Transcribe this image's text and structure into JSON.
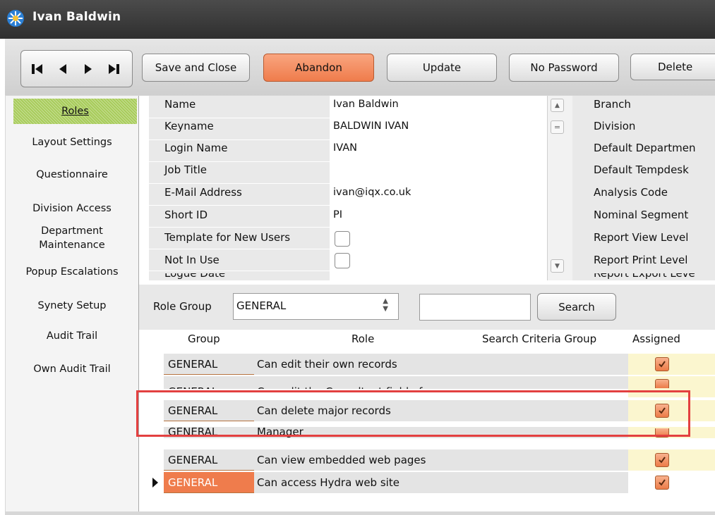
{
  "window": {
    "title": "Ivan Baldwin"
  },
  "toolbar": {
    "save_close": "Save and Close",
    "abandon": "Abandon",
    "update": "Update",
    "no_password": "No Password",
    "delete": "Delete"
  },
  "sidebar": {
    "items": [
      "Roles",
      "Layout Settings",
      "Questionnaire",
      "Division Access",
      "Department",
      "Maintenance",
      "Popup Escalations",
      "Synety Setup",
      "Audit Trail",
      "Own Audit Trail"
    ]
  },
  "fields": {
    "labels": [
      "Name",
      "Keyname",
      "Login Name",
      "Job Title",
      "E-Mail Address",
      "Short ID",
      "Template for New Users",
      "Not In Use",
      "Logue Date"
    ],
    "values": [
      "Ivan Baldwin",
      "BALDWIN IVAN",
      "IVAN",
      "",
      "ivan@iqx.co.uk",
      "PI"
    ]
  },
  "right_fields": [
    "Branch",
    "Division",
    "Default Departmen",
    "Default Tempdesk",
    "Analysis Code",
    "Nominal Segment",
    "Report View Level",
    "Report Print Level",
    "Report Export Leve"
  ],
  "filter": {
    "label": "Role Group",
    "value": "GENERAL",
    "search_value": "",
    "search_button": "Search"
  },
  "grid": {
    "headers": {
      "group": "Group",
      "role": "Role",
      "criteria": "Search Criteria Group",
      "assigned": "Assigned"
    },
    "rows": [
      {
        "group": "GENERAL",
        "role": "Can edit their own records"
      },
      {
        "group": "GENERAL",
        "role": "Can edit the Consultant field of"
      },
      {
        "group": "GENERAL",
        "role": "Can delete major records"
      },
      {
        "group": "GENERAL",
        "role": "Manager"
      },
      {
        "group": "GENERAL",
        "role": "Can view embedded web pages"
      },
      {
        "group": "GENERAL",
        "role": "Can access Hydra web site"
      }
    ]
  },
  "colors": {
    "accent_orange": "#ef7c4c",
    "active_green": "#a8cc5b",
    "highlight_red": "#e34040"
  }
}
